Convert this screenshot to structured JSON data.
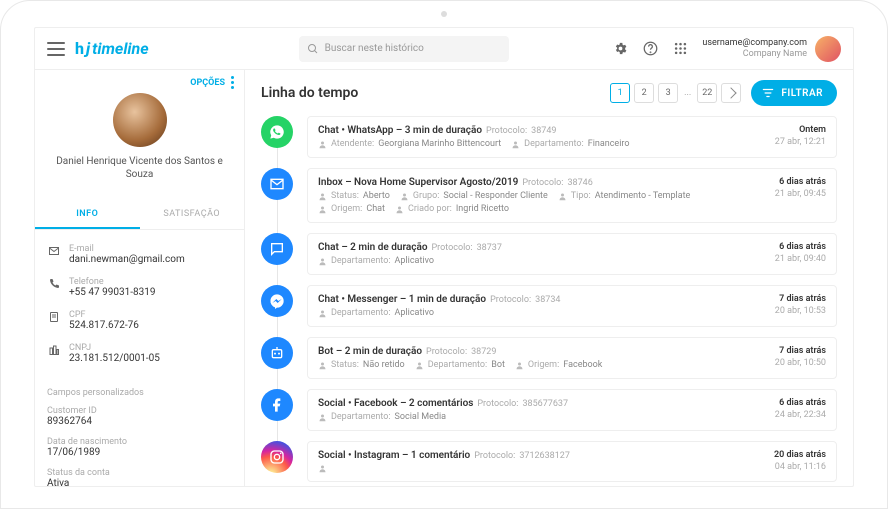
{
  "header": {
    "app_name": "timeline",
    "search_placeholder": "Buscar neste histórico",
    "user_email": "username@company.com",
    "company_name": "Company Name"
  },
  "sidebar": {
    "options_label": "OPÇÕES",
    "customer_name": "Daniel Henrique Vicente dos Santos e Souza",
    "tabs": [
      "INFO",
      "SATISFAÇÃO"
    ],
    "fields": [
      {
        "label": "E-mail",
        "value": "dani.newman@gmail.com"
      },
      {
        "label": "Telefone",
        "value": "+55 47 99031-8319"
      },
      {
        "label": "CPF",
        "value": "524.817.672-76"
      },
      {
        "label": "CNPJ",
        "value": "23.181.512/0001-05"
      }
    ],
    "custom_fields_header": "Campos personalizados",
    "custom_fields": [
      {
        "label": "Customer ID",
        "value": "89362764"
      },
      {
        "label": "Data de nascimento",
        "value": "17/06/1989"
      },
      {
        "label": "Status da conta",
        "value": "Ativa"
      }
    ]
  },
  "main": {
    "title": "Linha do tempo",
    "filter_label": "FILTRAR",
    "pagination": {
      "pages": [
        "1",
        "2",
        "3"
      ],
      "ellipsis": "...",
      "last": "22"
    },
    "protocol_label": "Protocolo:",
    "events": [
      {
        "channel": "whatsapp",
        "color": "bg-green",
        "title": "Chat  •  WhatsApp – 3 min de duração",
        "protocol": "38749",
        "meta": [
          {
            "icon": "user",
            "label": "Atendente:",
            "value": "Georgiana Marinho Bittencourt"
          },
          {
            "icon": "dept",
            "label": "Departamento:",
            "value": "Financeiro"
          }
        ],
        "relative": "Ontem",
        "absolute": "27 abr, 12:21"
      },
      {
        "channel": "inbox",
        "color": "bg-blue",
        "title": "Inbox – Nova Home Supervisor Agosto/2019",
        "protocol": "38746",
        "meta": [
          {
            "icon": "status",
            "label": "Status:",
            "value": "Aberto"
          },
          {
            "icon": "group",
            "label": "Grupo:",
            "value": "Social - Responder Cliente"
          },
          {
            "icon": "type",
            "label": "Tipo:",
            "value": "Atendimento - Template"
          }
        ],
        "meta2": [
          {
            "icon": "origin",
            "label": "Origem:",
            "value": "Chat"
          },
          {
            "icon": "creator",
            "label": "Criado por:",
            "value": "Ingrid Ricetto"
          }
        ],
        "relative": "6 dias atrás",
        "absolute": "21 abr, 09:45"
      },
      {
        "channel": "chat",
        "color": "bg-blue",
        "title": "Chat – 2 min de duração",
        "protocol": "38737",
        "meta": [
          {
            "icon": "dept",
            "label": "Departamento:",
            "value": "Aplicativo"
          }
        ],
        "relative": "6 dias atrás",
        "absolute": "21 abr, 09:40"
      },
      {
        "channel": "messenger",
        "color": "bg-blue",
        "title": "Chat  •  Messenger – 1 min de duração",
        "protocol": "38734",
        "meta": [
          {
            "icon": "dept",
            "label": "Departamento:",
            "value": "Aplicativo"
          }
        ],
        "relative": "7 dias atrás",
        "absolute": "20 abr, 10:53"
      },
      {
        "channel": "bot",
        "color": "bg-blue",
        "title": "Bot – 2 min de duração",
        "protocol": "38729",
        "meta": [
          {
            "icon": "status",
            "label": "Status:",
            "value": "Não retido"
          },
          {
            "icon": "dept",
            "label": "Departamento:",
            "value": "Bot"
          },
          {
            "icon": "origin",
            "label": "Origem:",
            "value": "Facebook"
          }
        ],
        "relative": "7 dias atrás",
        "absolute": "20 abr, 10:50"
      },
      {
        "channel": "facebook",
        "color": "bg-blue",
        "title": "Social  •  Facebook – 2 comentários",
        "protocol": "385677637",
        "meta": [
          {
            "icon": "dept",
            "label": "Departamento:",
            "value": "Social Media"
          }
        ],
        "relative": "6 dias atrás",
        "absolute": "24 abr, 22:34"
      },
      {
        "channel": "instagram",
        "color": "bg-insta",
        "title": "Social  •  Instagram – 1 comentário",
        "protocol": "3712638127",
        "meta": [
          {
            "icon": "dept",
            "label": "",
            "value": ""
          }
        ],
        "relative": "20 dias atrás",
        "absolute": "04 abr, 11:16"
      }
    ]
  }
}
